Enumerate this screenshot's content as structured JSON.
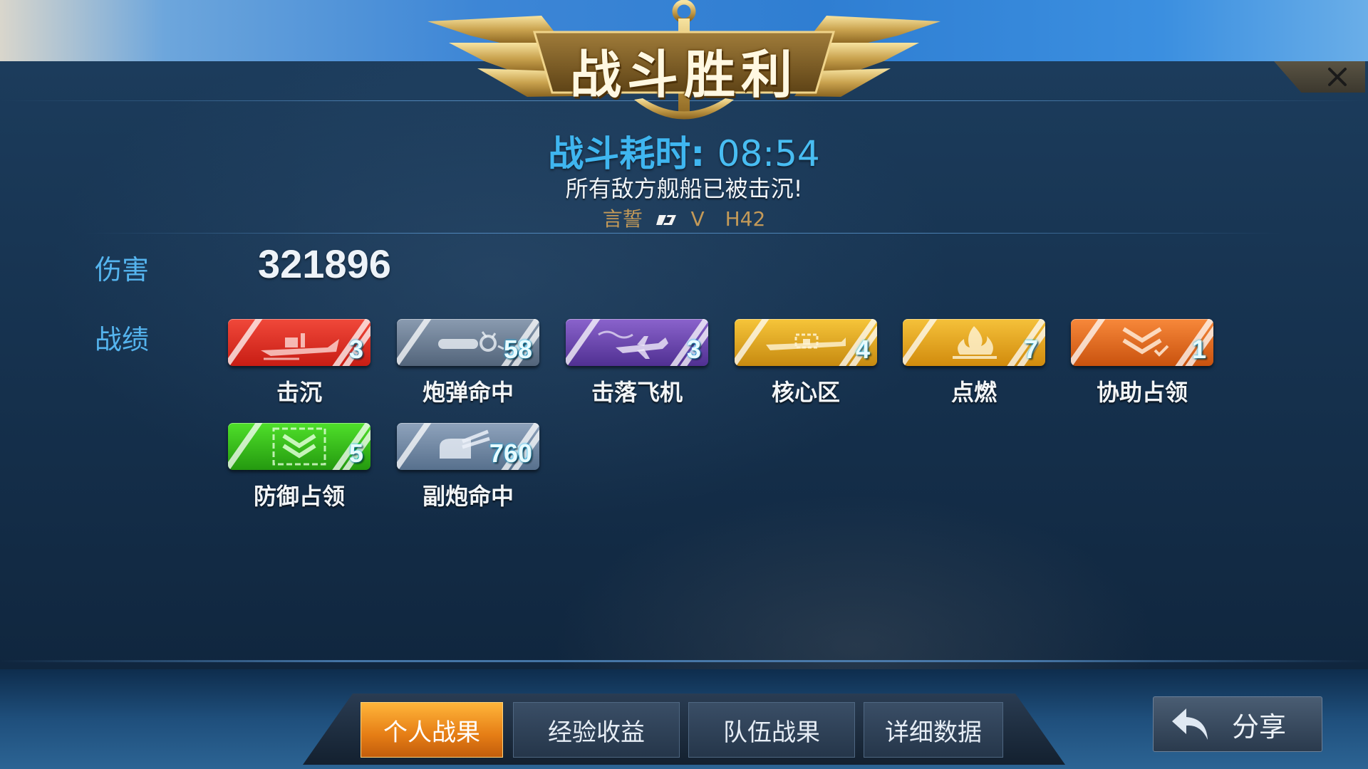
{
  "title": "战斗胜利",
  "duration": {
    "label": "战斗耗时:",
    "value": "08:54"
  },
  "result_message": "所有敌方舰船已被击沉!",
  "ship": {
    "name": "言誓",
    "tier": "V",
    "hull": "H42"
  },
  "damage": {
    "label": "伤害",
    "value": "321896"
  },
  "record": {
    "label": "战绩"
  },
  "medals": [
    {
      "name": "击沉",
      "count": "3",
      "icon": "warship-icon",
      "color": "#d8281e"
    },
    {
      "name": "炮弹命中",
      "count": "58",
      "icon": "shell-hit-icon",
      "color": "#6d7f94"
    },
    {
      "name": "击落飞机",
      "count": "3",
      "icon": "aircraft-icon",
      "color": "#6a47a8"
    },
    {
      "name": "核心区",
      "count": "4",
      "icon": "citadel-icon",
      "color": "#e0a21c"
    },
    {
      "name": "点燃",
      "count": "7",
      "icon": "fire-icon",
      "color": "#e7a417"
    },
    {
      "name": "协助占领",
      "count": "1",
      "icon": "assist-capture-icon",
      "color": "#e26a1c"
    },
    {
      "name": "防御占领",
      "count": "5",
      "icon": "defend-capture-icon",
      "color": "#3fb81e"
    },
    {
      "name": "副炮命中",
      "count": "760",
      "icon": "secondary-gun-icon",
      "color": "#7186a0"
    }
  ],
  "tabs": [
    {
      "label": "个人战果",
      "active": true
    },
    {
      "label": "经验收益",
      "active": false
    },
    {
      "label": "队伍战果",
      "active": false
    },
    {
      "label": "详细数据",
      "active": false
    }
  ],
  "share_label": "分享"
}
